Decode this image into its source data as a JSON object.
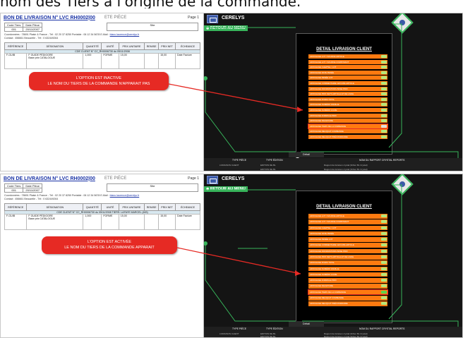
{
  "caption": "nom des Tiers à l'origine de la commande.",
  "panels": [
    {
      "doc": {
        "title": "BON DE LIVRAISON N° LVC  RH0002|00",
        "subtitle": "ETE PIÈCE",
        "page": "Page 1",
        "header_cells": [
          "Code Tiers",
          "Date Pièce",
          "001",
          "20/11/2007"
        ],
        "site": "Site",
        "address": "Coordonnées : 78691 Plaisir & France - Tél : 02 20 37 8250  Portable : 06 12 34 5678  E-Mail : ",
        "email": "blanc.laurence@cerelys.fr",
        "contact": "Contact : 456661 Beauzelle - Tél : 0 632449264",
        "columns": [
          "RÉFÉRENCE",
          "DÉSIGNATION",
          "QUANTITÉ",
          "UNITÉ",
          "PRIX UNITAIRE",
          "REMISE",
          "PRIX NET",
          "ÉCHEANCE"
        ],
        "group_row": "CDE CLIENT N° CC_RH0006730 du 05/11/2008",
        "item_ref": "F-GUIB",
        "item_designation": [
          "F GUIDE PÉDIOGRE",
          "Base prix CATALOGUE"
        ],
        "item_qty": "1,000",
        "item_unit": "FORME",
        "item_price": "15,00",
        "item_net": "15,00",
        "item_due": "Date Facture"
      },
      "callout": [
        "L'OPTION EST INACTIVE",
        "LE NOM DU TIERS DE LA COMMANDE N'APPARAIT PAS"
      ],
      "app": {
        "logo": "CERELYS",
        "back": "RETOUR AU MENU",
        "title": "DETAIL LIVRAISON CLIENT",
        "options": [
          "AFFICHAGE LOT / SOURCE ARTICLE",
          "AFFICHAGE LOT / SOURCE COMPOSANT",
          "AFFICHAGE CHEPTEL / LOT",
          "AFFICHAGE DATE PESÉE",
          "AFFICHAGE PESÉE LOT",
          "AFFICHAGE COMMENTAIRE GROUPE ARTICLE",
          "AFFICHAGE INFORMATIONS BASE PRIX",
          "AFFICHAGE PRIX NETS ARTICLE ET DE LIGNE",
          "AFFICHAGE POIDS TOTAL",
          "AFFICHAGE NUMÉRO FAMILLE",
          "AFFICHAGE NUMÉRO LIGNE",
          "AFFICHAGE FORMULE PRIX",
          "AFFICHAGE SIGNATURE",
          "AFFICHAGE TIERS DE LA COMMANDE",
          "AFFICHAGE RELIQUAT COMMANDE",
          "AFFICHAGE RELIQUAT PRÉCOMMANDE"
        ],
        "highlighted_index": 13,
        "footer": "Détail",
        "bottom_headers": [
          "TYPE PIÈCE",
          "TYPE ÉDITION",
          "NOM DU RAPPORT CRYSTAL REPORTS"
        ],
        "bottom_rows": [
          [
            "LIVRAISON CLIENT",
            "EDITION DE BL",
            "Rapport de livraison crystal (fichier BL Crystal)"
          ],
          [
            "",
            "EDITION DE BL",
            "Rapport de livraison crystal (fichier BL Crystal)"
          ]
        ]
      }
    },
    {
      "doc": {
        "title": "BON DE LIVRAISON N° LVC  RH0002|00",
        "subtitle": "ETE PIÈCE",
        "page": "Page 1",
        "header_cells": [
          "Code Tiers",
          "Date Pièce",
          "001",
          "20/11/2007"
        ],
        "site": "Site",
        "address": "Coordonnées : 78691 Plaisir & France - Tél : 02 20 37 8250  Portable : 06 12 34 5678  E-Mail : ",
        "email": "blanc.laurence@cerelys.fr",
        "contact": "Contact : 456661 Beauzelle - Tél : 0 632449264",
        "columns": [
          "RÉFÉRENCE",
          "DÉSIGNATION",
          "QUANTITÉ",
          "UNITÉ",
          "PRIX UNITAIRE",
          "REMISE",
          "PRIX NET",
          "ÉCHEANCE"
        ],
        "group_row": "CDE CLIENT N° CC_RH0006730 du 05/11/2008  TIERS: LAFAYE MARCEL (483)",
        "item_ref": "F-GUIB",
        "item_designation": [
          "F GUIDE PÉDIOGRE",
          "Base prix CATALOGUE"
        ],
        "item_qty": "1,000",
        "item_unit": "FORME",
        "item_price": "15,00",
        "item_net": "15,00",
        "item_due": "Date Facture"
      },
      "callout": [
        "L'OPTION EST ACTIVÉE",
        "LE NOM DU TIERS DE LA COMMANDE APPARAIT"
      ],
      "app": {
        "logo": "CERELYS",
        "back": "RETOUR AU MENU",
        "title": "DETAIL LIVRAISON CLIENT",
        "options": [
          "AFFICHAGE LOT / SOURCE ARTICLE",
          "AFFICHAGE LOT / SOURCE COMPOSANT",
          "AFFICHAGE CHEPTEL / LOT",
          "AFFICHAGE DATE PESÉE",
          "AFFICHAGE PESÉE LOT",
          "AFFICHAGE COMMENTAIRE GROUPE ARTICLE",
          "AFFICHAGE INFORMATIONS BASE PRIX",
          "AFFICHAGE PRIX NETS ARTICLE ET DE LIGNE",
          "AFFICHAGE POIDS TOTAL",
          "AFFICHAGE NUMÉRO FAMILLE",
          "AFFICHAGE NUMÉRO LIGNE",
          "AFFICHAGE FORMULE PRIX",
          "AFFICHAGE SIGNATURE",
          "AFFICHAGE TIERS DE LA COMMANDE",
          "AFFICHAGE RELIQUAT COMMANDE",
          "AFFICHAGE RELIQUAT PRÉCOMMANDE"
        ],
        "highlighted_index": 13,
        "footer": "Détail",
        "bottom_headers": [
          "TYPE PIÈCE",
          "TYPE ÉDITION",
          "NOM DU RAPPORT CRYSTAL REPORTS"
        ],
        "bottom_rows": [
          [
            "LIVRAISON CLIENT",
            "EDITION DE BL",
            "Rapport de livraison crystal (fichier BL Crystal)"
          ],
          [
            "",
            "EDITION DE BL",
            "Rapport de livraison crystal (fichier BL Crystal)"
          ]
        ]
      }
    }
  ],
  "colors": {
    "accent_green": "#37b45a",
    "option_orange": "#ff7a10",
    "callout_red": "#e62a24",
    "title_blue": "#1a33a6"
  }
}
